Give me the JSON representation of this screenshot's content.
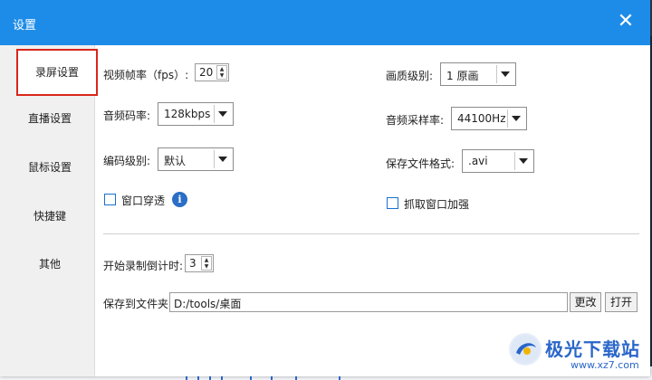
{
  "window": {
    "title": "设置"
  },
  "sidebar": {
    "items": [
      {
        "label": "录屏设置",
        "active": true
      },
      {
        "label": "直播设置"
      },
      {
        "label": "鼠标设置"
      },
      {
        "label": "快捷键"
      },
      {
        "label": "其他"
      }
    ]
  },
  "settings": {
    "fps": {
      "label": "视频帧率（fps）:",
      "value": "20"
    },
    "quality": {
      "label": "画质级别:",
      "value": "1 原画"
    },
    "bitrate": {
      "label": "音频码率:",
      "value": "128kbps"
    },
    "sample_rate": {
      "label": "音频采样率:",
      "value": "44100Hz"
    },
    "encode_level": {
      "label": "编码级别:",
      "value": "默认"
    },
    "file_format": {
      "label": "保存文件格式:",
      "value": ".avi"
    },
    "window_through": {
      "label": "窗口穿透",
      "checked": false
    },
    "capture_enhance": {
      "label": "抓取窗口加强",
      "checked": false
    },
    "countdown": {
      "label": "开始录制倒计时:",
      "value": "3"
    },
    "save_folder": {
      "label": "保存到文件夹:",
      "value": "D:/tools/桌面",
      "change_label": "更改",
      "open_label": "打开"
    }
  },
  "watermark": {
    "title": "极光下载站",
    "url": "www.xz7.com"
  },
  "colors": {
    "titlebar": "#1d8ce8",
    "active_border": "#d9261c",
    "checkbox_border": "#1a6fd0",
    "info_icon": "#2a6ec6"
  }
}
